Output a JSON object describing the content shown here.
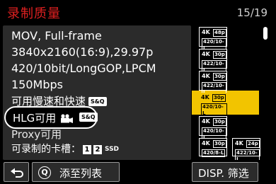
{
  "header": {
    "title": "录制质量",
    "page": "15/19"
  },
  "details": {
    "line1": "MOV, Full-frame",
    "line2": "3840x2160(16:9),29.97p",
    "line3": "420/10bit/LongGOP,LPCM",
    "line4": "150Mbps",
    "line5": "可用慢速和快速",
    "line5_badge": "S&Q",
    "hlg_label": "HLG可用",
    "hlg_badge": "S&Q",
    "line7": "Proxy可用",
    "line8": "可录制的卡槽：",
    "card1": "1",
    "card2": "2",
    "card_ssd": "SSD"
  },
  "formats": [
    {
      "res": "4K",
      "fps": "48p",
      "codec": "420/10-L"
    },
    {
      "res": "4K",
      "fps": "30p",
      "codec": "422/10-I"
    },
    {
      "res": "4K",
      "fps": "30p",
      "codec": "422/10-L"
    },
    {
      "res": "4K",
      "fps": "30p",
      "codec": "420/10-L"
    },
    {
      "res": "4K",
      "fps": "30p",
      "codec": "420/10-I"
    },
    {
      "res": "4K",
      "fps": "30p",
      "codec": "420/8-L"
    },
    {
      "res": "4K",
      "fps": "24p",
      "codec": "422/10-I"
    }
  ],
  "selected_index": 3,
  "footer": {
    "back_icon": "return-arrow-icon",
    "add_key": "Q",
    "add_label": "添至列表",
    "disp_label": "DISP. 筛选"
  },
  "colors": {
    "title": "#e02020",
    "selected": "#f2c400",
    "panel": "#2b2b2b"
  }
}
